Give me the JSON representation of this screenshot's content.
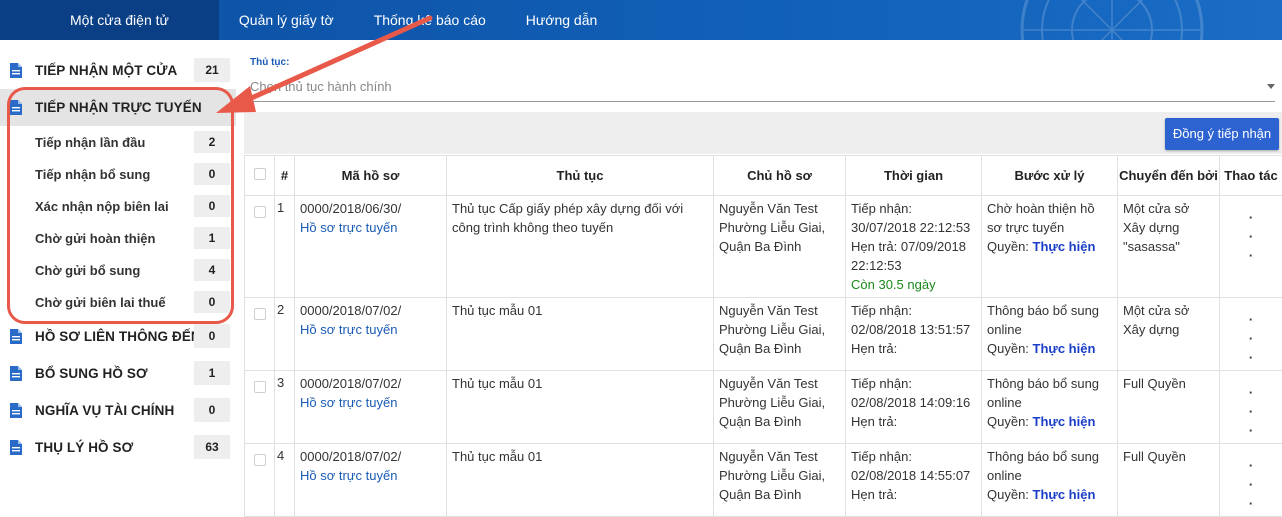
{
  "nav": {
    "items": [
      {
        "label": "Một cửa điện tử"
      },
      {
        "label": "Quản lý giấy tờ"
      },
      {
        "label": "Thống kê báo cáo"
      },
      {
        "label": "Hướng dẫn"
      }
    ]
  },
  "sidebar": {
    "items": [
      {
        "label": "TIẾP NHẬN MỘT CỬA",
        "count": "21"
      },
      {
        "label": "TIẾP NHẬN TRỰC TUYẾN",
        "count": ""
      }
    ],
    "subitems": [
      {
        "label": "Tiếp nhận lần đầu",
        "count": "2"
      },
      {
        "label": "Tiếp nhận bổ sung",
        "count": "0"
      },
      {
        "label": "Xác nhận nộp biên lai",
        "count": "0"
      },
      {
        "label": "Chờ gửi hoàn thiện",
        "count": "1"
      },
      {
        "label": "Chờ gửi bổ sung",
        "count": "4"
      },
      {
        "label": "Chờ gửi biên lai thuế",
        "count": "0"
      }
    ],
    "items2": [
      {
        "label": "HỒ SƠ LIÊN THÔNG ĐẾN",
        "count": "0"
      },
      {
        "label": "BỔ SUNG HỒ SƠ",
        "count": "1"
      },
      {
        "label": "NGHĨA VỤ TÀI CHÍNH",
        "count": "0"
      },
      {
        "label": "THỤ LÝ HỒ SƠ",
        "count": "63"
      }
    ]
  },
  "filter": {
    "label": "Thủ tục:",
    "placeholder": "Chọn thủ tục hành chính"
  },
  "toolbar": {
    "accept_label": "Đồng ý tiếp nhận"
  },
  "table": {
    "headers": [
      "#",
      "Mã hồ sơ",
      "Thủ tục",
      "Chủ hồ sơ",
      "Thời gian",
      "Bước xử lý",
      "Chuyển đến bởi",
      "Thao tác"
    ],
    "rows": [
      {
        "index": "1",
        "code": "0000/2018/06/30/",
        "code_link": "Hồ sơ trực tuyến",
        "procedure": "Thủ tục Cấp giấy phép xây dựng đối với công trình không theo tuyến",
        "owner_name": "Nguyễn Văn Test",
        "owner_addr": "Phường Liễu Giai, Quận Ba Đình",
        "received": "Tiếp nhận: 30/07/2018 22:12:53",
        "due": "Hẹn trả: 07/09/2018 22:12:53",
        "remaining": "Còn 30.5 ngày",
        "step": "Chờ hoàn thiện hồ sơ trực tuyến",
        "perm_label": "Quyền:",
        "perm_value": "Thực hiện",
        "from": "Một cửa sở Xây dựng \"sasassa\""
      },
      {
        "index": "2",
        "code": "0000/2018/07/02/",
        "code_link": "Hồ sơ trực tuyến",
        "procedure": "Thủ tục mẫu 01",
        "owner_name": "Nguyễn Văn Test",
        "owner_addr": "Phường Liễu Giai, Quận Ba Đình",
        "received": "Tiếp nhận: 02/08/2018 13:51:57",
        "due": "Hẹn trả:",
        "remaining": "",
        "step": "Thông báo bổ sung online",
        "perm_label": "Quyền:",
        "perm_value": "Thực hiện",
        "from": "Một cửa sở Xây dựng"
      },
      {
        "index": "3",
        "code": "0000/2018/07/02/",
        "code_link": "Hồ sơ trực tuyến",
        "procedure": "Thủ tục mẫu 01",
        "owner_name": "Nguyễn Văn Test",
        "owner_addr": "Phường Liễu Giai, Quận Ba Đình",
        "received": "Tiếp nhận: 02/08/2018 14:09:16",
        "due": "Hẹn trả:",
        "remaining": "",
        "step": "Thông báo bổ sung online",
        "perm_label": "Quyền:",
        "perm_value": "Thực hiện",
        "from": "Full Quyền"
      },
      {
        "index": "4",
        "code": "0000/2018/07/02/",
        "code_link": "Hồ sơ trực tuyến",
        "procedure": "Thủ tục mẫu 01",
        "owner_name": "Nguyễn Văn Test",
        "owner_addr": "Phường Liễu Giai, Quận Ba Đình",
        "received": "Tiếp nhận: 02/08/2018 14:55:07",
        "due": "Hẹn trả:",
        "remaining": "",
        "step": "Thông báo bổ sung online",
        "perm_label": "Quyền:",
        "perm_value": "Thực hiện",
        "from": "Full Quyền"
      }
    ]
  },
  "colors": {
    "nav_bg": "#1160b8",
    "nav_active": "#0a3f85",
    "accent_button": "#2d62d1",
    "highlight": "#e8594a",
    "link": "#1a5bb5",
    "remaining": "#1a8a1a"
  }
}
